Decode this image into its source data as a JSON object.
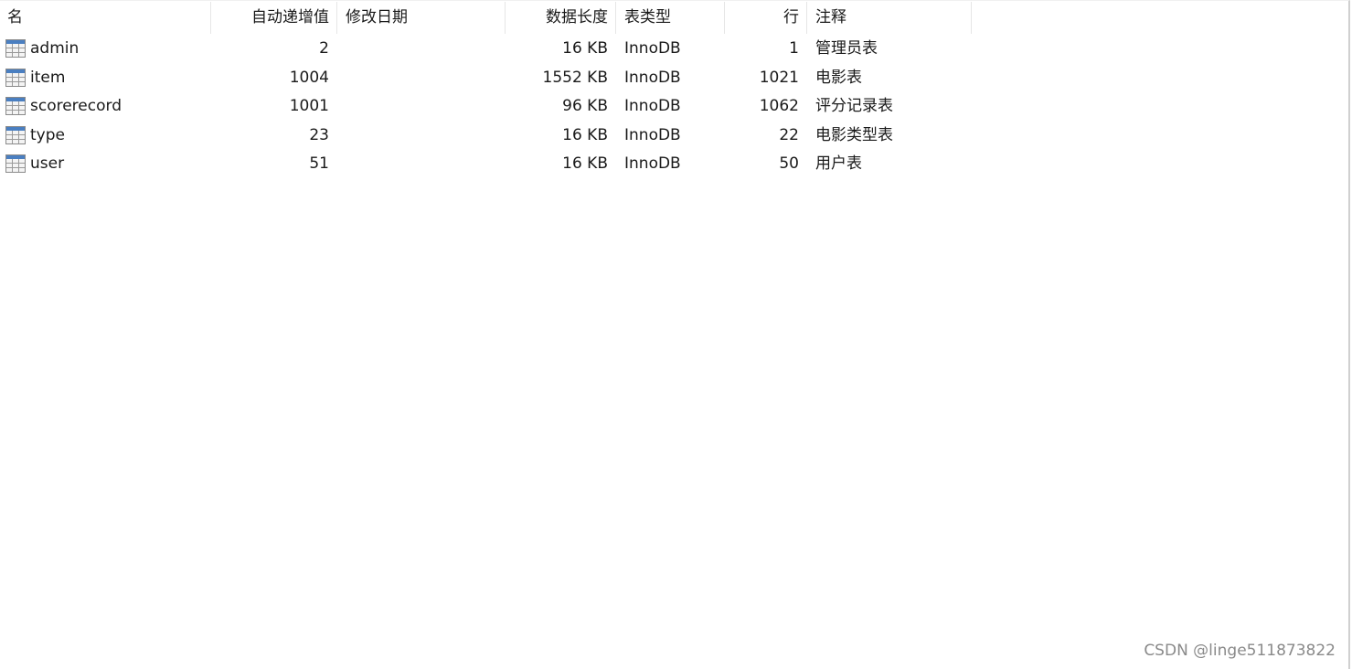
{
  "columns": {
    "name": "名",
    "auto_increment": "自动递增值",
    "modified_date": "修改日期",
    "data_length": "数据长度",
    "engine": "表类型",
    "rows": "行",
    "comment": "注释"
  },
  "tables": [
    {
      "icon": "table-icon",
      "name": "admin",
      "auto_increment": "2",
      "modified_date": "",
      "data_length": "16 KB",
      "engine": "InnoDB",
      "rows": "1",
      "comment": "管理员表"
    },
    {
      "icon": "table-icon",
      "name": "item",
      "auto_increment": "1004",
      "modified_date": "",
      "data_length": "1552 KB",
      "engine": "InnoDB",
      "rows": "1021",
      "comment": "电影表"
    },
    {
      "icon": "table-icon",
      "name": "scorerecord",
      "auto_increment": "1001",
      "modified_date": "",
      "data_length": "96 KB",
      "engine": "InnoDB",
      "rows": "1062",
      "comment": "评分记录表"
    },
    {
      "icon": "table-icon",
      "name": "type",
      "auto_increment": "23",
      "modified_date": "",
      "data_length": "16 KB",
      "engine": "InnoDB",
      "rows": "22",
      "comment": "电影类型表"
    },
    {
      "icon": "table-icon",
      "name": "user",
      "auto_increment": "51",
      "modified_date": "",
      "data_length": "16 KB",
      "engine": "InnoDB",
      "rows": "50",
      "comment": "用户表"
    }
  ],
  "watermark": "CSDN @linge511873822",
  "colors": {
    "icon_header": "#4a7fc1",
    "separator": "#e6e6e6"
  }
}
